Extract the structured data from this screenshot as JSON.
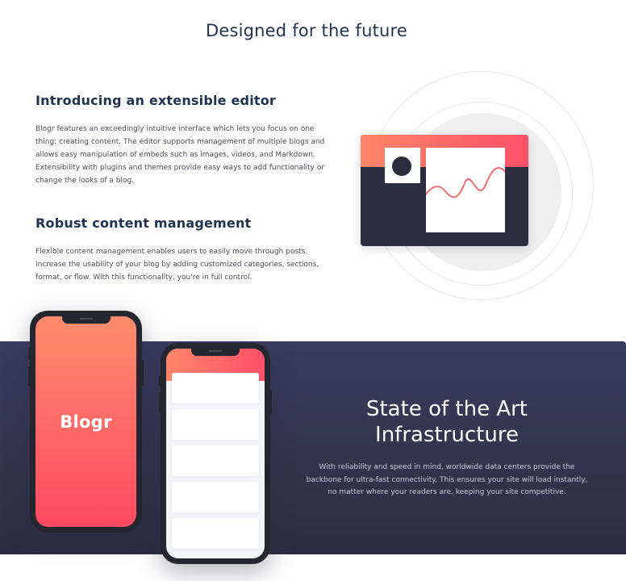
{
  "section": {
    "title": "Designed for the future"
  },
  "features": [
    {
      "heading": "Introducing an extensible editor",
      "body": "Blogr features an exceedingly intuitive interface which lets you focus on one thing: creating content. The editor supports management of multiple blogs and allows easy manipulation of embeds such as images, videos, and Markdown. Extensibility with plugins and themes provide easy ways to add functionality or change the looks of a blog."
    },
    {
      "heading": "Robust content management",
      "body": "Flexible content management enables users to easily move through posts. Increase the usability of your blog by adding customized categories, sections, format, or flow. With this functionality, you're in full control."
    }
  ],
  "infrastructure": {
    "title": "State of the Art Infrastructure",
    "body": "With reliability and speed in mind, worldwide data centers provide the backbone for ultra-fast connectivity. This ensures your site will load instantly, no matter where your readers are, keeping your site competitive."
  },
  "phone_brand": "Blogr",
  "colors": {
    "heading": "#1f3251",
    "gradient_start": "#ff8668",
    "gradient_end": "#ff4f69",
    "dark_band": "#3b3c5e"
  },
  "icons": {
    "editor_illustration": "editor-window-illustration",
    "phones": "phone-mockup-illustration"
  }
}
